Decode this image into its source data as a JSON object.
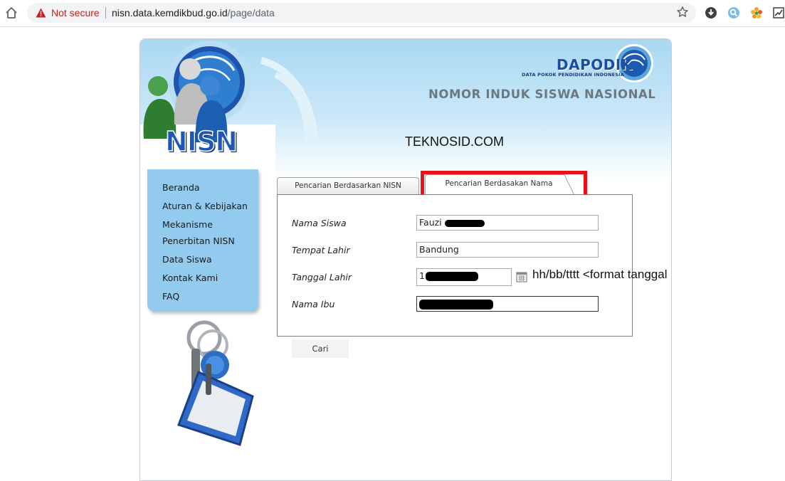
{
  "browser": {
    "security_label": "Not secure",
    "url_host": "nisn.data.kemdikbud.go.id",
    "url_path": "/page/data"
  },
  "header": {
    "logo_text": "DAPODIK",
    "logo_subtitle": "DATA POKOK PENDIDIKAN INDONESIA",
    "title": "NOMOR INDUK SISWA NASIONAL",
    "nisn_logo_text": "NISN",
    "watermark": "TEKNOSID.COM"
  },
  "sidebar": {
    "items": [
      {
        "label": "Beranda"
      },
      {
        "label": "Aturan & Kebijakan"
      },
      {
        "label": "Mekanisme Penerbitan NISN"
      },
      {
        "label": "Data Siswa"
      },
      {
        "label": "Kontak Kami"
      },
      {
        "label": "FAQ"
      }
    ]
  },
  "tabs": [
    {
      "label": "Pencarian Berdasarkan NISN",
      "active": false
    },
    {
      "label": "Pencarian Berdasakan Nama",
      "active": true
    }
  ],
  "form": {
    "nama_siswa": {
      "label": "Nama Siswa",
      "value": "Fauzi"
    },
    "tempat_lahir": {
      "label": "Tempat Lahir",
      "value": "Bandung"
    },
    "tanggal_lahir": {
      "label": "Tanggal Lahir",
      "value": "1"
    },
    "nama_ibu": {
      "label": "Nama Ibu",
      "value": ""
    },
    "submit_label": "Cari"
  },
  "annotation": {
    "date_hint": "hh/bb/tttt <format tanggal",
    "highlight_color": "#e8121b"
  },
  "icons": [
    "home-icon",
    "warning-icon",
    "star-icon",
    "calendar-icon"
  ]
}
